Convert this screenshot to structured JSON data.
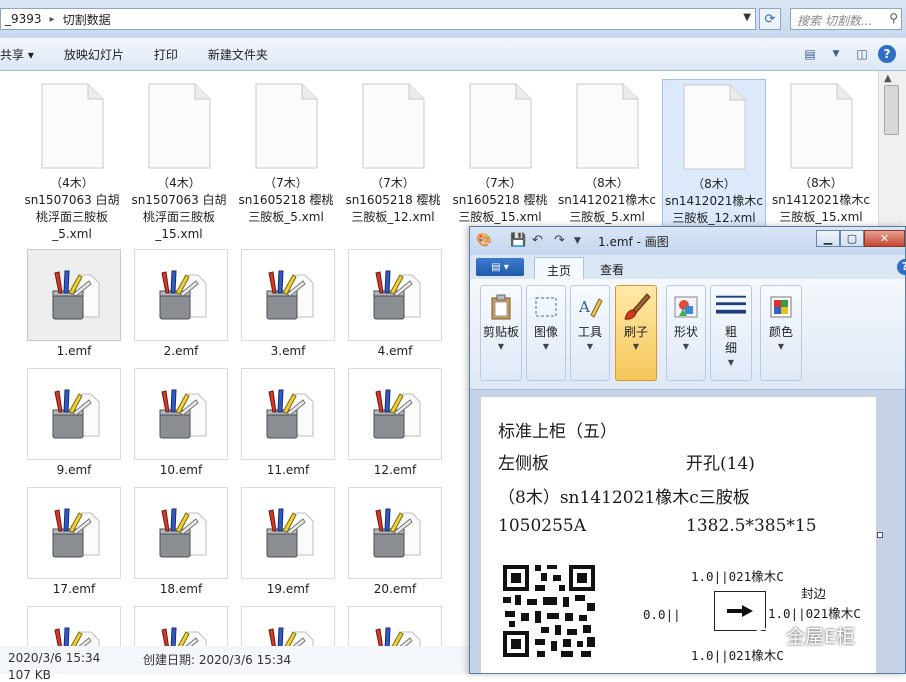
{
  "explorer": {
    "address": {
      "segment_1": "_9393",
      "segment_2": "切割数据"
    },
    "search_placeholder": "搜索 切割数...",
    "toolbar": {
      "share": "共享 ▾",
      "slideshow": "放映幻灯片",
      "print": "打印",
      "new_folder": "新建文件夹"
    },
    "xml_files": [
      {
        "label": "（4木）\nsn1507063 白胡\n桃浮面三胺板\n_5.xml",
        "selected": false
      },
      {
        "label": "（4木）\nsn1507063 白胡\n桃浮面三胺板\n_15.xml",
        "selected": false
      },
      {
        "label": "（7木）\nsn1605218 樱桃\n三胺板_5.xml",
        "selected": false
      },
      {
        "label": "（7木）\nsn1605218 樱桃\n三胺板_12.xml",
        "selected": false
      },
      {
        "label": "（7木）\nsn1605218 樱桃\n三胺板_15.xml",
        "selected": false
      },
      {
        "label": "（8木）\nsn1412021橡木c\n三胺板_5.xml",
        "selected": false
      },
      {
        "label": "（8木）\nsn1412021橡木c\n三胺板_12.xml",
        "selected": true
      },
      {
        "label": "（8木）\nsn1412021橡木c\n三胺板_15.xml",
        "selected": false
      }
    ],
    "emf_files": [
      [
        "1.emf",
        "2.emf",
        "3.emf",
        "4.emf"
      ],
      [
        "9.emf",
        "10.emf",
        "11.emf",
        "12.emf"
      ],
      [
        "17.emf",
        "18.emf",
        "19.emf",
        "20.emf"
      ]
    ],
    "status": {
      "modified": "2020/3/6 15:34",
      "created_label": "创建日期: 2020/3/6 15:34",
      "size": "107 KB"
    }
  },
  "paint": {
    "title": "1.emf - 画图",
    "tabs": {
      "home": "主页",
      "view": "查看"
    },
    "groups": {
      "clipboard": "剪贴板",
      "image": "图像",
      "tools": "工具",
      "brushes": "刷子",
      "shapes": "形状",
      "size": "粗\n细",
      "colors": "颜色"
    },
    "label": {
      "line1": "标准上柜（五）",
      "line2_left": "左侧板",
      "line2_right": "开孔(14)",
      "line3": "（8木）sn1412021橡木c三胺板",
      "line4_left": "1050255A",
      "line4_right": "1382.5*385*15",
      "edge_top": "1.0||021橡木C",
      "edge_title": "封边",
      "edge_left": "0.0||",
      "edge_right": "1.0||021橡木C",
      "edge_bottom": "1.0||021橡木C"
    }
  },
  "watermark": "全屋E柜",
  "colors": {
    "accent": "#2d6fc4",
    "brush_active": "#f6c65a"
  }
}
